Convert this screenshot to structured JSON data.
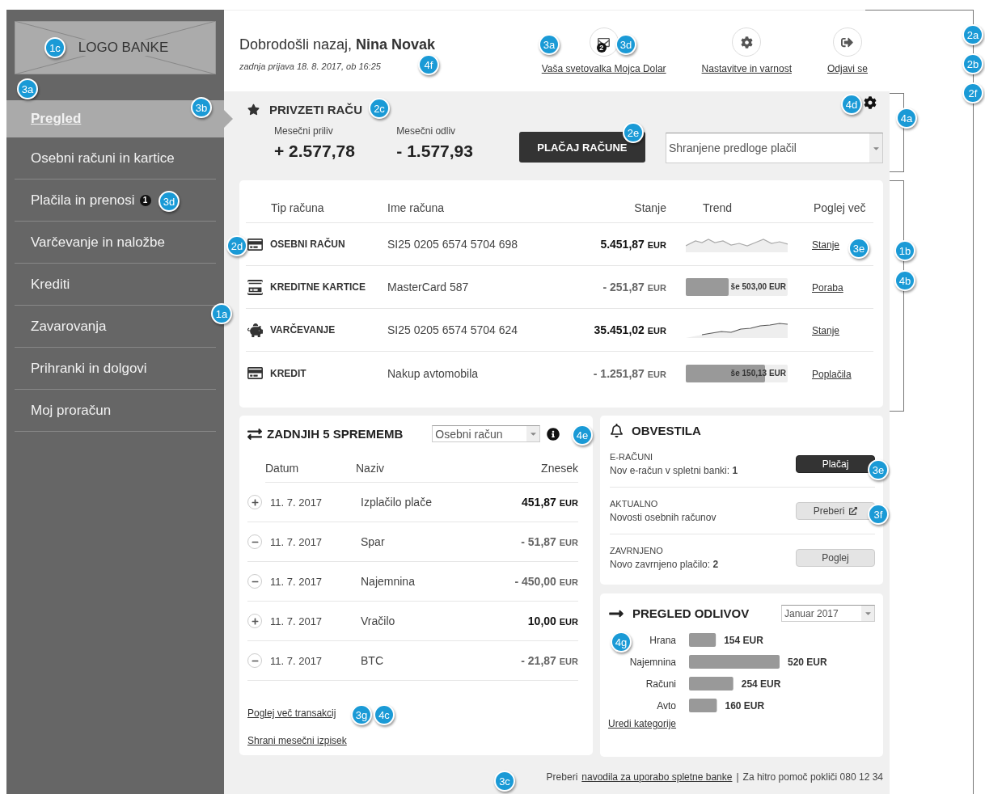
{
  "sidebar": {
    "logo": "LOGO BANKE",
    "items": [
      {
        "label": "Pregled",
        "selected": true
      },
      {
        "label": "Osebni računi in kartice",
        "selected": false
      },
      {
        "label": "Plačila in prenosi",
        "selected": false,
        "badge": "1"
      },
      {
        "label": "Varčevanje in naložbe",
        "selected": false
      },
      {
        "label": "Krediti",
        "selected": false
      },
      {
        "label": "Zavarovanja",
        "selected": false
      },
      {
        "label": "Prihranki in dolgovi",
        "selected": false
      },
      {
        "label": "Moj proračun",
        "selected": false
      }
    ]
  },
  "header": {
    "greeting": "Dobrodošli nazaj,",
    "user_name": "Nina Novak",
    "last_login": "zadnja prijava 18. 8. 2017, ob 16:25",
    "actions": [
      {
        "kind": "messages",
        "label": "Vaša svetovalka Mojca Dolar",
        "badge": "2"
      },
      {
        "kind": "settings",
        "label": "Nastavitve in varnost"
      },
      {
        "kind": "logout",
        "label": "Odjavi se"
      }
    ]
  },
  "favorites": {
    "title": "PRIVZETI RAČU",
    "inflow_label": "Mesečni priliv",
    "inflow": "+ 2.577,78",
    "outflow_label": "Mesečni odliv",
    "outflow": "- 1.577,93",
    "pay_button": "PLAČAJ RAČUNE",
    "templates_select": {
      "value": "Shranjene predloge plačil"
    }
  },
  "accounts": {
    "columns": [
      "Tip računa",
      "Ime računa",
      "Stanje",
      "Trend",
      "Poglej več"
    ],
    "rows": [
      {
        "kind": "card",
        "type": "OSEBNI RAČUN",
        "name": "SI25 0205 6574 5704 698",
        "balance": "5.451,87",
        "currency": "EUR",
        "emphasis": true,
        "trend": {
          "kind": "sparkline"
        },
        "link": "Stanje"
      },
      {
        "kind": "credit_card",
        "type": "KREDITNE KARTICE",
        "name": "MasterCard 587",
        "balance": "- 251,87",
        "currency": "EUR",
        "emphasis": false,
        "trend": {
          "kind": "bar",
          "level": 0.42,
          "label": "še 503,00 EUR"
        },
        "link": "Poraba"
      },
      {
        "kind": "savings",
        "type": "VARČEVANJE",
        "name": "SI25 0205 6574 5704 624",
        "balance": "35.451,02",
        "currency": "EUR",
        "emphasis": true,
        "trend": {
          "kind": "sparkline"
        },
        "link": "Stanje"
      },
      {
        "kind": "card",
        "type": "KREDIT",
        "name": "Nakup avtomobila",
        "balance": "- 1.251,87",
        "currency": "EUR",
        "emphasis": false,
        "trend": {
          "kind": "bar",
          "level": 0.78,
          "label": "še 150,13 EUR"
        },
        "link": "Poplačila"
      }
    ]
  },
  "transactions": {
    "title": "ZADNJIH 5 SPREMEMB",
    "account_select": {
      "value": "Osebni račun"
    },
    "columns": [
      "Datum",
      "Naziv",
      "Znesek"
    ],
    "rows": [
      {
        "kind": "in",
        "date": "11. 7. 2017",
        "name": "Izplačilo plače",
        "amount": "451,87",
        "currency": "EUR"
      },
      {
        "kind": "out",
        "date": "11. 7. 2017",
        "name": "Spar",
        "amount": "- 51,87",
        "currency": "EUR"
      },
      {
        "kind": "out",
        "date": "11. 7. 2017",
        "name": "Najemnina",
        "amount": "- 450,00",
        "currency": "EUR"
      },
      {
        "kind": "in",
        "date": "11. 7. 2017",
        "name": "Vračilo",
        "amount": "10,00",
        "currency": "EUR"
      },
      {
        "kind": "out",
        "date": "11. 7. 2017",
        "name": "BTC",
        "amount": "- 21,87",
        "currency": "EUR"
      }
    ],
    "links": [
      "Poglej več transakcij",
      "Shrani mesečni izpisek"
    ]
  },
  "notifications": {
    "title": "OBVESTILA",
    "items": [
      {
        "category": "E-RAČUNI",
        "text": "Nov e-račun v spletni banki: **1**",
        "button": {
          "label": "Plačaj",
          "kind": "primary",
          "external": false
        }
      },
      {
        "category": "AKTUALNO",
        "text": "Novosti osebnih računov",
        "button": {
          "label": "Preberi",
          "kind": "secondary",
          "external": true
        }
      },
      {
        "category": "ZAVRNJENO",
        "text": "Novo zavrnjeno plačilo: **2**",
        "button": {
          "label": "Poglej",
          "kind": "secondary",
          "external": false
        }
      }
    ]
  },
  "outflows": {
    "title": "PREGLED ODLIVOV",
    "month_select": {
      "value": "Januar 2017"
    },
    "chart_data": {
      "type": "bar",
      "orientation": "horizontal",
      "categories": [
        "Hrana",
        "Najemnina",
        "Računi",
        "Avto"
      ],
      "values": [
        154,
        520,
        254,
        160
      ],
      "value_labels": [
        "154 EUR",
        "520 EUR",
        "254 EUR",
        "160 EUR"
      ]
    },
    "link": "Uredi kategorije"
  },
  "footer": {
    "prefix": "Preberi",
    "link": "navodila za uporabo spletne banke",
    "separator": "|",
    "help": "Za hitro pomoč pokliči 080 12 34"
  },
  "annotation_markers": [
    {
      "label": "1c"
    },
    {
      "label": "3a"
    },
    {
      "label": "3b"
    },
    {
      "label": "2c"
    },
    {
      "label": "4f"
    },
    {
      "label": "3a"
    },
    {
      "label": "3d"
    },
    {
      "label": "2a"
    },
    {
      "label": "2b"
    },
    {
      "label": "2f"
    },
    {
      "label": "4d"
    },
    {
      "label": "4a"
    },
    {
      "label": "2e"
    },
    {
      "label": "2d"
    },
    {
      "label": "3e"
    },
    {
      "label": "1b"
    },
    {
      "label": "4b"
    },
    {
      "label": "1a"
    },
    {
      "label": "3d"
    },
    {
      "label": "4e"
    },
    {
      "label": "3e"
    },
    {
      "label": "3f"
    },
    {
      "label": "4g"
    },
    {
      "label": "3g"
    },
    {
      "label": "4c"
    },
    {
      "label": "3c"
    }
  ]
}
